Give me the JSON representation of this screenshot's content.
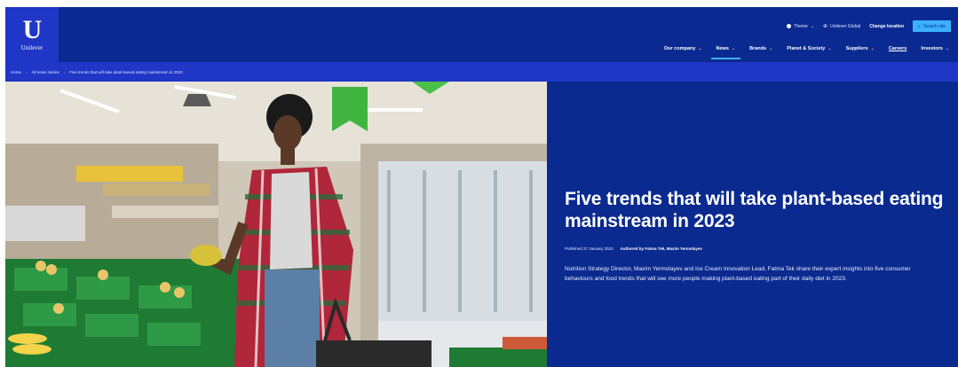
{
  "brand": {
    "logo_text": "Unilever",
    "colors": {
      "primary": "#1f36c7",
      "dark": "#0a2a8f",
      "accent": "#3bb0ff"
    }
  },
  "utility": {
    "theme_label": "Theme",
    "site_label": "Unilever Global",
    "change_location_label": "Change location",
    "search_label": "Search site"
  },
  "nav": {
    "items": [
      {
        "label": "Our company",
        "has_dropdown": true
      },
      {
        "label": "News",
        "has_dropdown": true,
        "active": true
      },
      {
        "label": "Brands",
        "has_dropdown": true
      },
      {
        "label": "Planet & Society",
        "has_dropdown": true
      },
      {
        "label": "Suppliers",
        "has_dropdown": true
      },
      {
        "label": "Careers",
        "has_dropdown": false
      },
      {
        "label": "Investors",
        "has_dropdown": true
      }
    ]
  },
  "breadcrumb": {
    "items": [
      "Home",
      "All news stories",
      "Five trends that will take plant-based eating mainstream in 2023"
    ]
  },
  "article": {
    "title": "Five trends that will take plant-based eating mainstream in 2023",
    "published": "Published 27 January 2023",
    "authored_by": "Authored by Fatma Tek, Maxim Yermolayev",
    "summary": "Nutrition Strategy Director, Maxim Yermolayev and Ice Cream Innovation Lead, Fatma Tek share their expert insights into five consumer behaviours and food trends that will see more people making plant-based eating part of their daily diet in 2023."
  }
}
